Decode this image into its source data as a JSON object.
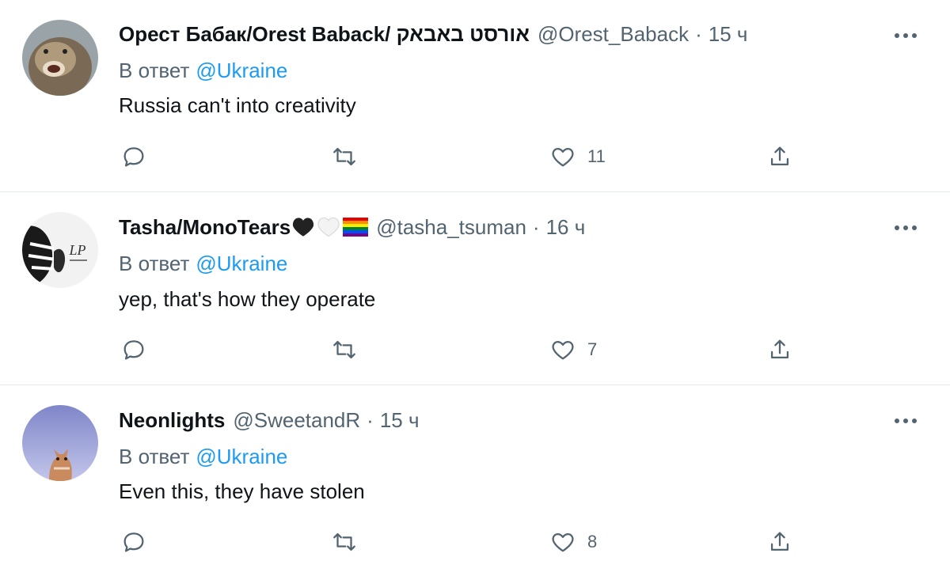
{
  "tweets": [
    {
      "name": "Орест Бабак/Orest Baback/ אורסט באבאק",
      "handle": "@Orest_Baback",
      "dot": "·",
      "time": "15 ч",
      "reply_prefix": "В ответ",
      "reply_to": "@Ukraine",
      "text": "Russia can't into creativity",
      "likes": "11"
    },
    {
      "name": "Tasha/MonoTears",
      "name_emoji": [
        "black-heart",
        "white-heart",
        "rainbow-flag"
      ],
      "handle": "@tasha_tsuman",
      "dot": "·",
      "time": "16 ч",
      "reply_prefix": "В ответ",
      "reply_to": "@Ukraine",
      "text": "yep, that's how they operate",
      "likes": "7",
      "avatar_text": "LP"
    },
    {
      "name": "Neonlights",
      "handle": "@SweetandR",
      "dot": "·",
      "time": "15 ч",
      "reply_prefix": "В ответ",
      "reply_to": "@Ukraine",
      "text": "Even this, they have stolen",
      "likes": "8"
    }
  ],
  "colors": {
    "secondary_text": "#536471",
    "link": "#1d9bf0",
    "divider": "#e6ecf0",
    "primary_text": "#0f1419"
  }
}
